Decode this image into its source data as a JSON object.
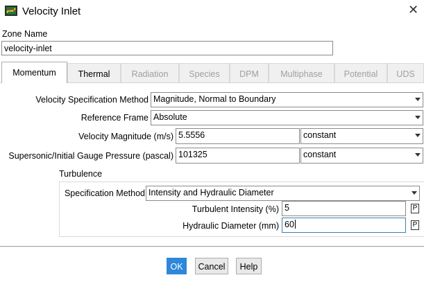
{
  "window": {
    "title": "Velocity Inlet",
    "close_glyph": "✕"
  },
  "zone": {
    "label": "Zone Name",
    "value": "velocity-inlet"
  },
  "tabs": [
    {
      "label": "Momentum",
      "state": "active"
    },
    {
      "label": "Thermal",
      "state": "enabled"
    },
    {
      "label": "Radiation",
      "state": "disabled"
    },
    {
      "label": "Species",
      "state": "disabled"
    },
    {
      "label": "DPM",
      "state": "disabled"
    },
    {
      "label": "Multiphase",
      "state": "disabled"
    },
    {
      "label": "Potential",
      "state": "disabled"
    },
    {
      "label": "UDS",
      "state": "disabled"
    }
  ],
  "momentum": {
    "spec_method": {
      "label": "Velocity Specification Method",
      "value": "Magnitude, Normal to Boundary"
    },
    "ref_frame": {
      "label": "Reference Frame",
      "value": "Absolute"
    },
    "velocity_magnitude": {
      "label": "Velocity Magnitude (m/s)",
      "value": "5.5556",
      "profile": "constant"
    },
    "gauge_pressure": {
      "label": "Supersonic/Initial Gauge Pressure (pascal)",
      "value": "101325",
      "profile": "constant"
    }
  },
  "turbulence": {
    "heading": "Turbulence",
    "spec_method": {
      "label": "Specification Method",
      "value": "Intensity and Hydraulic Diameter"
    },
    "intensity": {
      "label": "Turbulent Intensity (%)",
      "value": "5",
      "param_glyph": "P"
    },
    "hydraulic_diameter": {
      "label": "Hydraulic Diameter (mm)",
      "value": "60",
      "param_glyph": "P"
    }
  },
  "buttons": {
    "ok": "OK",
    "cancel": "Cancel",
    "help": "Help"
  },
  "colors": {
    "accent": "#2e87d8",
    "focus_border": "#3c7fb1"
  },
  "icons": {
    "app": "fluent-app-icon",
    "dropdown": "chevron-down-icon"
  }
}
